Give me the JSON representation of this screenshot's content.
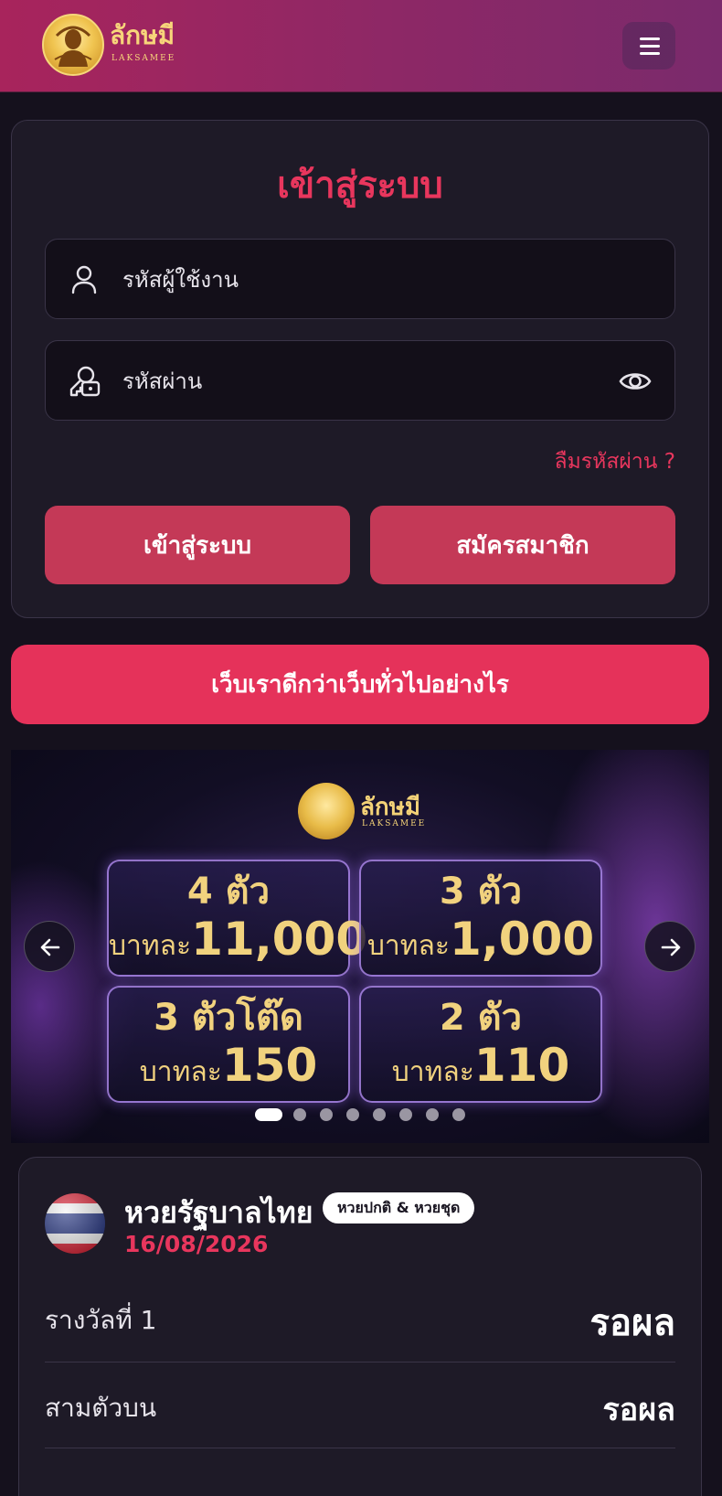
{
  "header": {
    "logo_text": "ลักษมี",
    "logo_sub": "LAKSAMEE",
    "menu_icon": "hamburger-menu-icon"
  },
  "login": {
    "title": "เข้าสู่ระบบ",
    "username_placeholder": "รหัสผู้ใช้งาน",
    "password_placeholder": "รหัสผ่าน",
    "forgot_label": "ลืมรหัสผ่าน ?",
    "login_button": "เข้าสู่ระบบ",
    "register_button": "สมัครสมาชิก"
  },
  "promo_button": "เว็บเราดีกว่าเว็บทั่วไปอย่างไร",
  "banner": {
    "logo_text": "ลักษมี",
    "logo_sub": "LAKSAMEE",
    "prizes": [
      {
        "label": "4 ตัว",
        "prefix": "บาทละ",
        "amount": "11,000"
      },
      {
        "label": "3 ตัว",
        "prefix": "บาทละ",
        "amount": "1,000"
      },
      {
        "label": "3 ตัวโต๊ด",
        "prefix": "บาทละ",
        "amount": "150"
      },
      {
        "label": "2 ตัว",
        "prefix": "บาทละ",
        "amount": "110"
      }
    ],
    "slide_count": 8,
    "active_slide": 1
  },
  "lottery": {
    "name": "หวยรัฐบาลไทย",
    "badge": "หวยปกติ & หวยชุด",
    "date": "16/08/2026",
    "rows": [
      {
        "label": "รางวัลที่ 1",
        "value": "รอผล"
      },
      {
        "label": "สามตัวบน",
        "value": "รอผล"
      }
    ]
  },
  "colors": {
    "accent": "#e8365d",
    "button": "#c43957",
    "header_start": "#a8245c",
    "header_end": "#7a2a6c",
    "background": "#15111d",
    "card": "#1e1a27"
  }
}
